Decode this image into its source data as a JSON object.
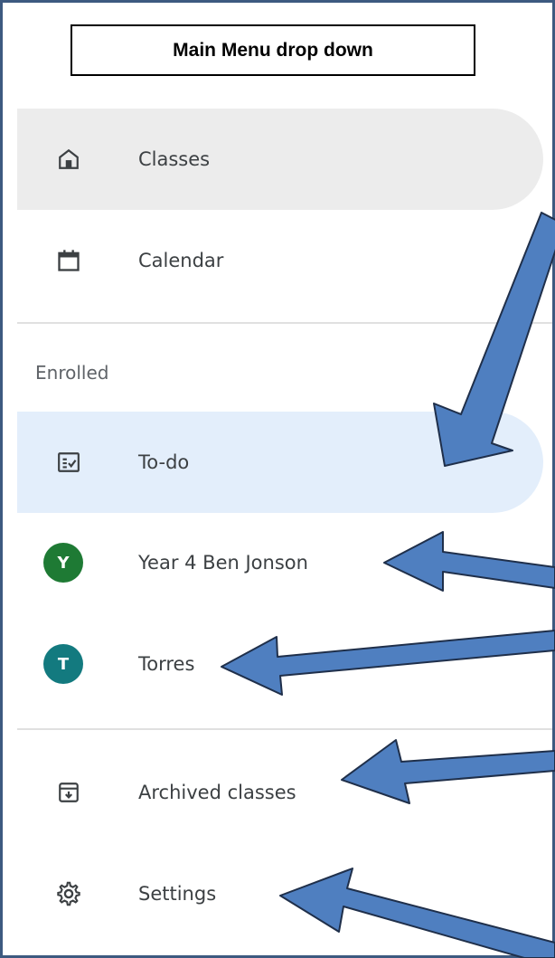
{
  "annotation": {
    "title": "Main Menu drop down"
  },
  "menu": {
    "top_items": [
      {
        "label": "Classes",
        "icon": "home-icon",
        "active": true
      },
      {
        "label": "Calendar",
        "icon": "calendar-icon",
        "active": false
      }
    ],
    "enrolled_heading": "Enrolled",
    "enrolled_items": [
      {
        "label": "To-do",
        "icon": "todo-icon",
        "active": true
      },
      {
        "label": "Year 4 Ben Jonson",
        "avatar_letter": "Y",
        "avatar_color": "#1e7a34"
      },
      {
        "label": "Torres",
        "avatar_letter": "T",
        "avatar_color": "#137a7f"
      }
    ],
    "bottom_items": [
      {
        "label": "Archived classes",
        "icon": "archive-icon"
      },
      {
        "label": "Settings",
        "icon": "gear-icon"
      }
    ]
  },
  "colors": {
    "frame": "#3d5a80",
    "arrow_fill": "#4f7fc0",
    "arrow_stroke": "#1f2f4a",
    "active_grey": "#ececec",
    "active_blue": "#e3eefb"
  }
}
